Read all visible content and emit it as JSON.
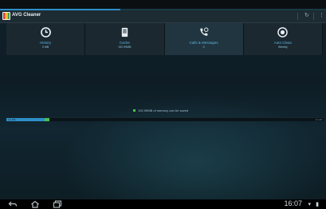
{
  "app": {
    "title": "AVG Cleaner"
  },
  "progress": {
    "loading_fraction": 0.37
  },
  "actionbar": {
    "icons": [
      "refresh-icon",
      "overflow-menu-icon"
    ]
  },
  "tiles": [
    {
      "label": "History",
      "value": "0 MB",
      "icon": "clock-icon"
    },
    {
      "label": "Cache",
      "value": "192,99MB",
      "icon": "storage-icon"
    },
    {
      "label": "Calls & Messages",
      "value": "0",
      "icon": "phone-icon"
    },
    {
      "label": "Auto Clean",
      "value": "Weekly",
      "icon": "auto-clean-icon"
    }
  ],
  "memory": {
    "message": "192,99MB of memory can be saved"
  },
  "storage": {
    "used_label": "1,2 GB",
    "total_label": "11 GB",
    "used_fraction": 0.12,
    "saveable_fraction": 0.015
  },
  "nav": {
    "buttons": [
      "back-icon",
      "home-icon",
      "recent-apps-icon"
    ]
  },
  "status": {
    "time": "16:07"
  },
  "colors": {
    "accent": "#2d8fc8",
    "saveable": "#4bbf4b",
    "tile_text": "#5fb6e0"
  }
}
